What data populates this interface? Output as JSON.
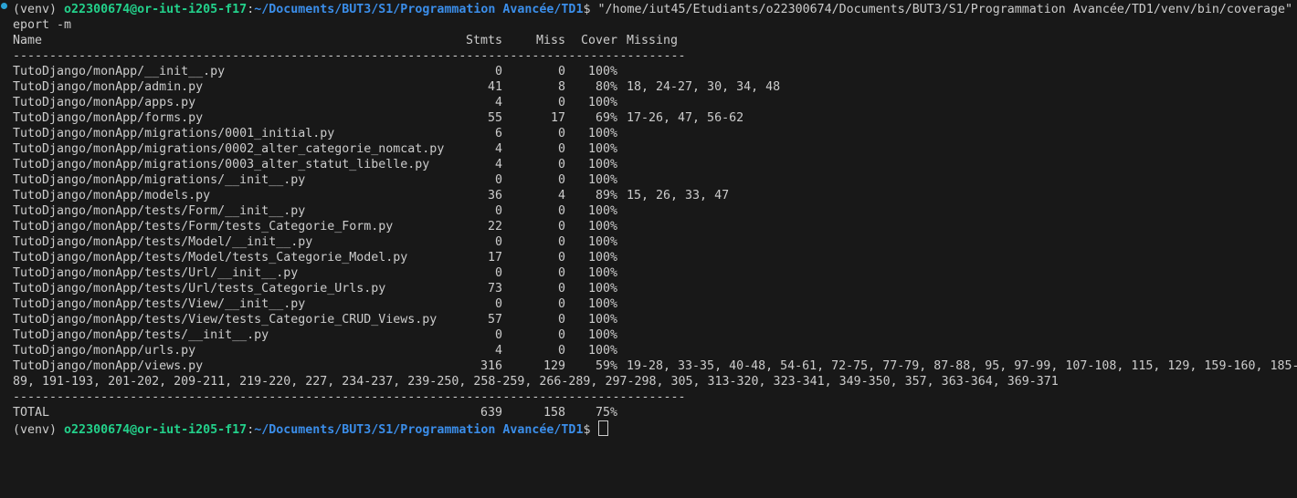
{
  "terminal": {
    "prompt_env": "(venv) ",
    "prompt_user": "o22300674@or-iut-i205-f17",
    "prompt_sep": ":",
    "prompt_path": "~/Documents/BUT3/S1/Programmation Avancée/TD1",
    "prompt_end": "$ ",
    "command_line1": "\"/home/iut45/Etudiants/o22300674/Documents/BUT3/S1/Programmation Avancée/TD1/venv/bin/coverage\"",
    "command_line2": "eport -m",
    "header": {
      "name": "Name",
      "stmts": "Stmts",
      "miss": "Miss",
      "cover": "Cover",
      "missing": "Missing"
    },
    "separator": "--------------------------------------------------------------------------------------------",
    "rows": [
      {
        "name": "TutoDjango/monApp/__init__.py",
        "stmts": "0",
        "miss": "0",
        "cover": "100%",
        "missing": ""
      },
      {
        "name": "TutoDjango/monApp/admin.py",
        "stmts": "41",
        "miss": "8",
        "cover": "80%",
        "missing": "18, 24-27, 30, 34, 48"
      },
      {
        "name": "TutoDjango/monApp/apps.py",
        "stmts": "4",
        "miss": "0",
        "cover": "100%",
        "missing": ""
      },
      {
        "name": "TutoDjango/monApp/forms.py",
        "stmts": "55",
        "miss": "17",
        "cover": "69%",
        "missing": "17-26, 47, 56-62"
      },
      {
        "name": "TutoDjango/monApp/migrations/0001_initial.py",
        "stmts": "6",
        "miss": "0",
        "cover": "100%",
        "missing": ""
      },
      {
        "name": "TutoDjango/monApp/migrations/0002_alter_categorie_nomcat.py",
        "stmts": "4",
        "miss": "0",
        "cover": "100%",
        "missing": ""
      },
      {
        "name": "TutoDjango/monApp/migrations/0003_alter_statut_libelle.py",
        "stmts": "4",
        "miss": "0",
        "cover": "100%",
        "missing": ""
      },
      {
        "name": "TutoDjango/monApp/migrations/__init__.py",
        "stmts": "0",
        "miss": "0",
        "cover": "100%",
        "missing": ""
      },
      {
        "name": "TutoDjango/monApp/models.py",
        "stmts": "36",
        "miss": "4",
        "cover": "89%",
        "missing": "15, 26, 33, 47"
      },
      {
        "name": "TutoDjango/monApp/tests/Form/__init__.py",
        "stmts": "0",
        "miss": "0",
        "cover": "100%",
        "missing": ""
      },
      {
        "name": "TutoDjango/monApp/tests/Form/tests_Categorie_Form.py",
        "stmts": "22",
        "miss": "0",
        "cover": "100%",
        "missing": ""
      },
      {
        "name": "TutoDjango/monApp/tests/Model/__init__.py",
        "stmts": "0",
        "miss": "0",
        "cover": "100%",
        "missing": ""
      },
      {
        "name": "TutoDjango/monApp/tests/Model/tests_Categorie_Model.py",
        "stmts": "17",
        "miss": "0",
        "cover": "100%",
        "missing": ""
      },
      {
        "name": "TutoDjango/monApp/tests/Url/__init__.py",
        "stmts": "0",
        "miss": "0",
        "cover": "100%",
        "missing": ""
      },
      {
        "name": "TutoDjango/monApp/tests/Url/tests_Categorie_Urls.py",
        "stmts": "73",
        "miss": "0",
        "cover": "100%",
        "missing": ""
      },
      {
        "name": "TutoDjango/monApp/tests/View/__init__.py",
        "stmts": "0",
        "miss": "0",
        "cover": "100%",
        "missing": ""
      },
      {
        "name": "TutoDjango/monApp/tests/View/tests_Categorie_CRUD_Views.py",
        "stmts": "57",
        "miss": "0",
        "cover": "100%",
        "missing": ""
      },
      {
        "name": "TutoDjango/monApp/tests/__init__.py",
        "stmts": "0",
        "miss": "0",
        "cover": "100%",
        "missing": ""
      },
      {
        "name": "TutoDjango/monApp/urls.py",
        "stmts": "4",
        "miss": "0",
        "cover": "100%",
        "missing": ""
      },
      {
        "name": "TutoDjango/monApp/views.py",
        "stmts": "316",
        "miss": "129",
        "cover": "59%",
        "missing": "19-28, 33-35, 40-48, 54-61, 72-75, 77-79, 87-88, 95, 97-99, 107-108, 115, 129, 159-160, 185-"
      }
    ],
    "wrap_line": "89, 191-193, 201-202, 209-211, 219-220, 227, 234-237, 239-250, 258-259, 266-289, 297-298, 305, 313-320, 323-341, 349-350, 357, 363-364, 369-371",
    "total": {
      "name": "TOTAL",
      "stmts": "639",
      "miss": "158",
      "cover": "75%"
    }
  }
}
